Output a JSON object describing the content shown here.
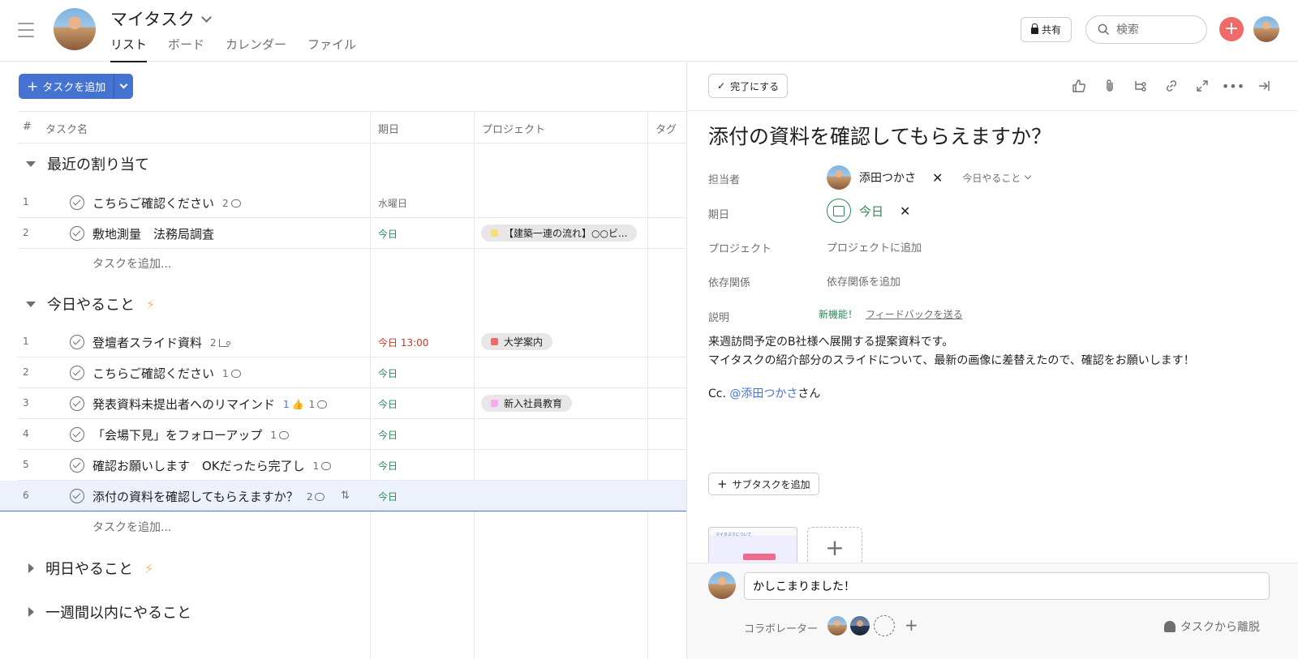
{
  "header": {
    "project_title": "マイタスク",
    "tabs": [
      {
        "label": "リスト",
        "active": true
      },
      {
        "label": "ボード",
        "active": false
      },
      {
        "label": "カレンダー",
        "active": false
      },
      {
        "label": "ファイル",
        "active": false
      }
    ],
    "share_label": "共有",
    "search_placeholder": "検索"
  },
  "toolbar": {
    "add_task_label": "タスクを追加"
  },
  "table": {
    "columns": [
      "#",
      "タスク名",
      "期日",
      "プロジェクト",
      "タグ"
    ]
  },
  "sections": [
    {
      "title": "最近の割り当て",
      "expanded": true,
      "rows": [
        {
          "num": "1",
          "name": "こちらご確認ください",
          "meta_count": "2",
          "meta_icon": "comment-icon",
          "due": "水曜日",
          "due_color": "grey",
          "project": "",
          "project_color": ""
        },
        {
          "num": "2",
          "name": "敷地測量　法務局調査",
          "meta_count": "",
          "meta_icon": "",
          "due": "今日",
          "due_color": "green",
          "project": "【建築一連の流れ】○○ビ...",
          "project_color": "#f8df72"
        }
      ],
      "add_label": "タスクを追加..."
    },
    {
      "title": "今日やること",
      "icon": "lightning-icon",
      "expanded": true,
      "rows": [
        {
          "num": "1",
          "name": "登壇者スライド資料",
          "meta_count": "2",
          "meta_icon": "subtask-icon",
          "due": "今日 13:00",
          "due_color": "red",
          "project": "大学案内",
          "project_color": "#f06a6a"
        },
        {
          "num": "2",
          "name": "こちらご確認ください",
          "meta_count": "1",
          "meta_icon": "comment-icon",
          "due": "今日",
          "due_color": "green",
          "project": "",
          "project_color": ""
        },
        {
          "num": "3",
          "name": "発表資料未提出者へのリマインド",
          "meta_likes": "1",
          "meta_count": "1",
          "meta_icon": "comment-icon",
          "due": "今日",
          "due_color": "green",
          "project": "新入社員教育",
          "project_color": "#f9aaef"
        },
        {
          "num": "4",
          "name": "「会場下見」をフォローアップ",
          "meta_count": "1",
          "meta_icon": "comment-icon",
          "due": "今日",
          "due_color": "green",
          "project": "",
          "project_color": ""
        },
        {
          "num": "5",
          "name": "確認お願いします　OKだったら完了し",
          "meta_count": "1",
          "meta_icon": "comment-icon",
          "due": "今日",
          "due_color": "green",
          "project": "",
          "project_color": ""
        },
        {
          "num": "6",
          "name": "添付の資料を確認してもらえますか？",
          "meta_count": "2",
          "meta_icon": "comment-icon",
          "due": "今日",
          "due_color": "green",
          "project": "",
          "project_color": "",
          "selected": true
        }
      ],
      "add_label": "タスクを追加..."
    },
    {
      "title": "明日やること",
      "icon": "lightning-icon",
      "expanded": false
    },
    {
      "title": "一週間以内にやること",
      "expanded": false
    }
  ],
  "detail": {
    "complete_label": "完了にする",
    "title": "添付の資料を確認してもらえますか？",
    "assignee_label": "担当者",
    "assignee_name": "添田つかさ",
    "assignee_section": "今日やること",
    "due_label": "期日",
    "due_value": "今日",
    "project_label": "プロジェクト",
    "project_placeholder": "プロジェクトに追加",
    "dependency_label": "依存関係",
    "dependency_placeholder": "依存関係を追加",
    "description_label": "説明",
    "new_feature_label": "新機能！",
    "feedback_link": "フィードバックを送る",
    "description_lines": [
      "来週訪問予定のB社様へ展開する提案資料です。",
      "マイタスクの紹介部分のスライドについて、最新の画像に差替えたので、確認をお願いします！"
    ],
    "cc_prefix": "Cc. ",
    "cc_mention": "@添田つかさ",
    "cc_suffix": "さん",
    "add_subtask_label": "サブタスクを追加",
    "attachment_thumb_title": "マイタスクについて",
    "comment_value": "かしこまりました！",
    "collaborators_label": "コラボレーター",
    "leave_label": "タスクから離脱"
  },
  "colors": {
    "accent_blue": "#4573d2",
    "add_red": "#f06a6a",
    "due_green": "#2b8a54",
    "due_red": "#c7372f"
  }
}
